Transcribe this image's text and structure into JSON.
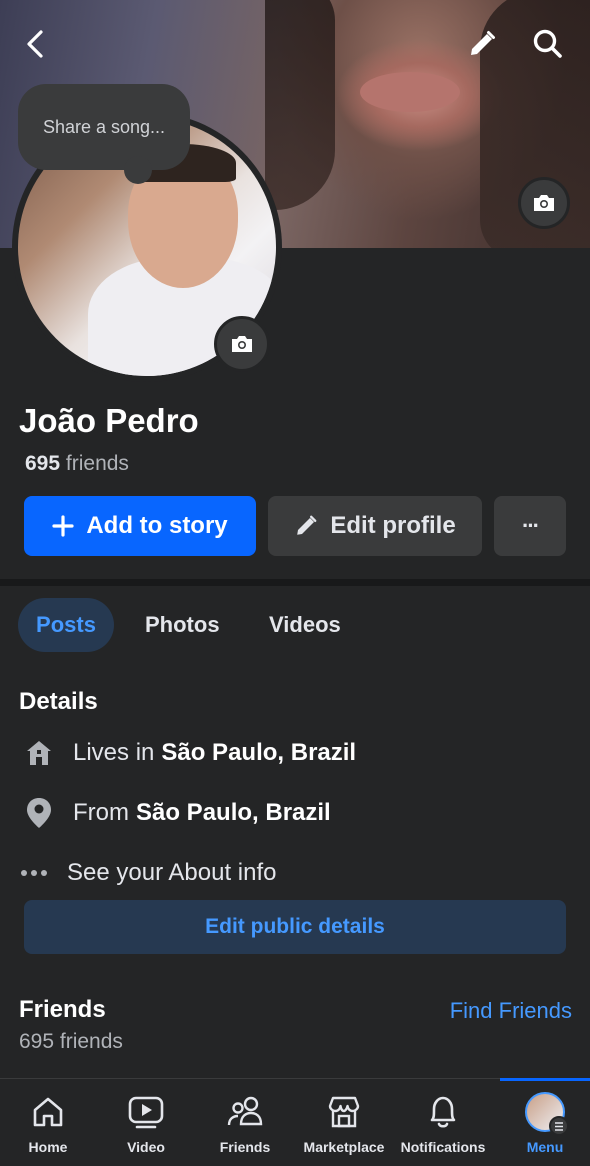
{
  "header": {
    "back_icon": "chevron-left-icon",
    "edit_icon": "pencil-icon",
    "search_icon": "search-icon"
  },
  "profile": {
    "song_prompt": "Share a song...",
    "name": "João Pedro",
    "friends_number": "695",
    "friends_word": "friends"
  },
  "actions": {
    "add_story": "Add to story",
    "edit_profile": "Edit profile",
    "more": "···"
  },
  "tabs": [
    {
      "label": "Posts",
      "active": true
    },
    {
      "label": "Photos",
      "active": false
    },
    {
      "label": "Videos",
      "active": false
    }
  ],
  "details": {
    "title": "Details",
    "lives_prefix": "Lives in",
    "lives_value": "São Paulo, Brazil",
    "from_prefix": "From",
    "from_value": "São Paulo, Brazil",
    "about": "See your About info",
    "edit_button": "Edit public details"
  },
  "friends": {
    "title": "Friends",
    "find_link": "Find Friends",
    "count_text": "695 friends"
  },
  "bottom_nav": [
    {
      "label": "Home",
      "icon": "home-icon"
    },
    {
      "label": "Video",
      "icon": "video-icon"
    },
    {
      "label": "Friends",
      "icon": "friends-icon"
    },
    {
      "label": "Marketplace",
      "icon": "marketplace-icon"
    },
    {
      "label": "Notifications",
      "icon": "bell-icon"
    },
    {
      "label": "Menu",
      "icon": "avatar",
      "active": true
    }
  ],
  "colors": {
    "background": "#242526",
    "accent": "#0866ff",
    "link": "#4599ff",
    "button_secondary": "#3a3b3c"
  }
}
